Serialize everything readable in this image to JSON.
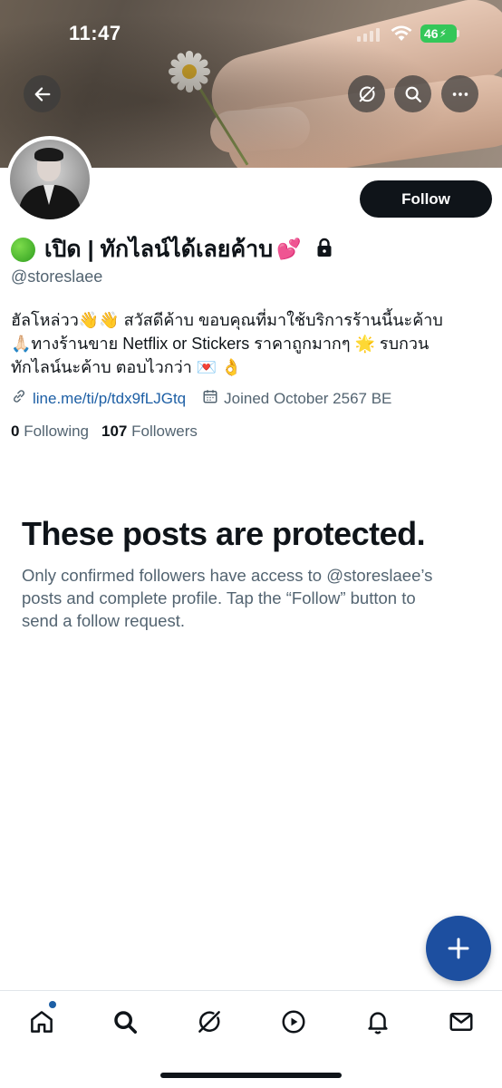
{
  "status_bar": {
    "time": "11:47",
    "battery": "46"
  },
  "profile": {
    "display_name": "เปิด | ทักไลน์ได้เลยค้าบ",
    "handle": "@storeslaee",
    "bio_lines": [
      "ฮัลโหล่วว👋👋 สวัสดีค้าบ ขอบคุณที่มาใช้บริการร้านนี้นะค้าบ",
      "🙏🏻ทางร้านขาย Netflix or Stickers ราคาถูกมากๆ 🌟 รบกวน",
      "ทักไลน์นะค้าบ ตอบไวกว่า 💌 👌"
    ],
    "link": "line.me/ti/p/tdx9fLJGtq",
    "joined": "Joined October 2567 BE",
    "following_count": "0",
    "following_label": "Following",
    "followers_count": "107",
    "followers_label": "Followers",
    "follow_button": "Follow"
  },
  "protected_notice": {
    "title": "These posts are protected.",
    "lines": [
      "Only confirmed followers have access to @storeslaee’s",
      "posts and complete profile. Tap the “Follow” button to",
      "send a follow request."
    ]
  },
  "icons": {
    "back": "back-arrow-icon",
    "grok": "grok-icon",
    "search": "search-icon",
    "more": "more-icon",
    "compose": "plus-icon",
    "nav": [
      "home-icon",
      "search-icon",
      "grok-icon",
      "video-icon",
      "bell-icon",
      "mail-icon"
    ]
  },
  "colors": {
    "follow_button_bg": "#0f1419",
    "link": "#1d5fa5",
    "fab": "#1d4fa0",
    "secondary_text": "#536471"
  }
}
